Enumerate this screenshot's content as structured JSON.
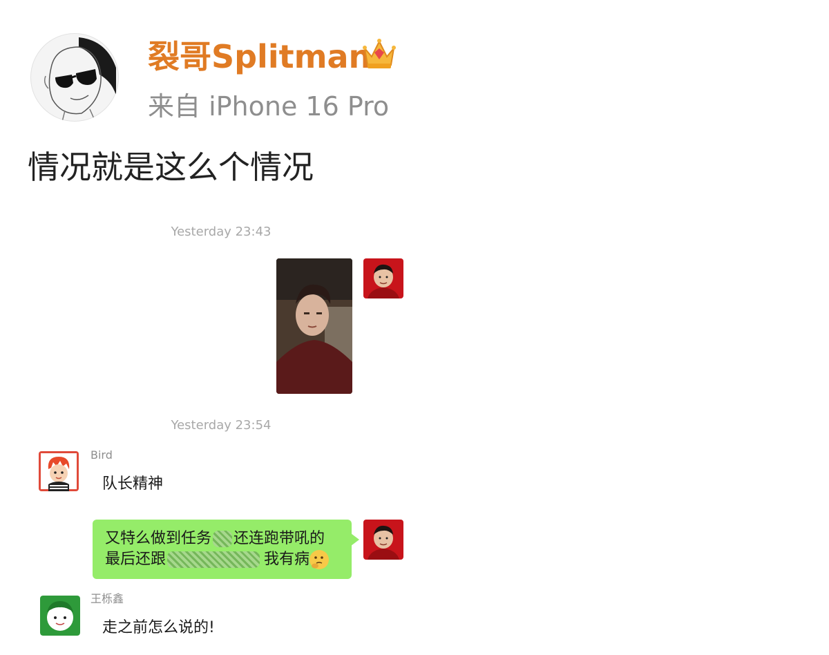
{
  "post": {
    "author": "裂哥Splitman",
    "crown_badge_icon": "crown-icon",
    "source": "来自 iPhone 16 Pro",
    "text": "情况就是这么个情况"
  },
  "chat": {
    "timestamps": [
      "Yesterday 23:43",
      "Yesterday 23:54"
    ],
    "messages": [
      {
        "sender": "",
        "type": "video",
        "side": "right"
      },
      {
        "sender": "Bird",
        "type": "text",
        "side": "left",
        "text": "队长精神"
      },
      {
        "sender": "",
        "type": "text",
        "side": "right",
        "line1_a": "又特么做到任务",
        "line1_b": "还连跑带吼的",
        "line2_a": "最后还跟",
        "line2_b": "我有病"
      },
      {
        "sender": "王栎鑫",
        "type": "text",
        "side": "left",
        "text": "走之前怎么说的!"
      }
    ]
  },
  "colors": {
    "author": "#e07b24",
    "bubble_green": "#95ec69",
    "timestamp": "#a8a8a8"
  }
}
